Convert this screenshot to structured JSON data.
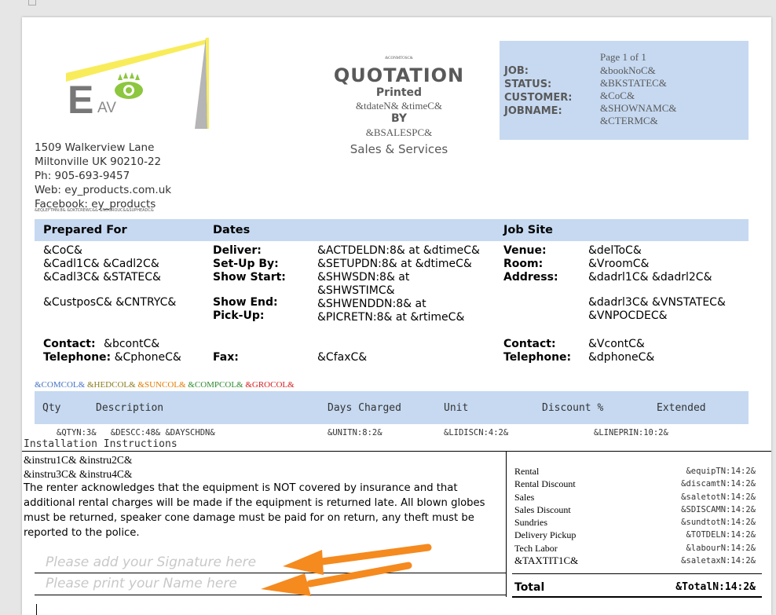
{
  "colors": {
    "accent_band": "#c6d9f1",
    "arrow": "#f58a1f",
    "logo_yellow": "#f8ec5a",
    "logo_green": "#8dc63f",
    "logo_gray": "#b5b5b5",
    "logo_text": "#777777"
  },
  "logo": {
    "letter": "E",
    "suffix": "AV"
  },
  "company": {
    "address1": "1509 Walkerview Lane",
    "address2": "Miltonville UK 90210-22",
    "phone": "Ph: 905-693-9457",
    "web": "Web: ey_products.com.uk",
    "facebook": "Facebook: ey_products",
    "tiny_line": "&EQLEFTMN:8& &DKTCREWC&& &NOGROUC&&SUPHEADC&"
  },
  "header": {
    "tiny_code": "&CONMTOSC&",
    "title": "QUOTATION",
    "printed": "Printed",
    "date_line": "&tdateN& &timeC&",
    "by": "BY",
    "salesp": "&BSALESPC&",
    "services": "Sales & Services"
  },
  "jobbox": {
    "page": "Page 1 of 1",
    "labels": [
      "JOB:",
      "STATUS:",
      "CUSTOMER:",
      "JOBNAME:"
    ],
    "values": [
      "&bookNoC&",
      "&BKSTATEC&",
      "&CoC&",
      "&SHOWNAMC&",
      "&CTERMC&"
    ]
  },
  "band1": {
    "prepared": "Prepared For",
    "dates": "Dates",
    "jobsite": "Job Site"
  },
  "prepared": {
    "line1": "&CoC&",
    "line2": "&Cadl1C& &Cadl2C&",
    "line3": "&Cadl3C& &STATEC&",
    "line4": "&CustposC& &CNTRYC&",
    "contact_label": "Contact:",
    "contact_value": "&bcontC&",
    "tel_label": "Telephone:",
    "tel_value": "&CphoneC&"
  },
  "dates": {
    "deliver_label": "Deliver:",
    "deliver_value": "&ACTDELDN:8& at &dtimeC&",
    "setup_label": "Set-Up By:",
    "setup_value": "&SETUPDN:8& at &dtimeC&",
    "showstart_label": "Show Start:",
    "showstart_value1": "&SHWSDN:8& at",
    "showstart_value2": "&SHWSTIMC&",
    "showend_label": "Show End:",
    "showend_value": "&SHWENDDN:8& at",
    "pickup_label": "Pick-Up:",
    "pickup_value": "&PICRETN:8& at &rtimeC&",
    "fax_label": "Fax:",
    "fax_value": "&CfaxC&"
  },
  "jobsite": {
    "venue_label": "Venue:",
    "venue_value": "&delToC&",
    "room_label": "Room:",
    "room_value": "&VroomC&",
    "address_label": "Address:",
    "address_value": "&dadrl1C& &dadrl2C&",
    "address_value2": "&dadrl3C& &VNSTATEC&",
    "address_value3": "&VNPOCDEC&",
    "contact_label": "Contact:",
    "contact_value": "&VcontC&",
    "tel_label": "Telephone:",
    "tel_value": "&dphoneC&"
  },
  "colcodes": [
    {
      "text": "&COMCOL&",
      "color": "#4472c4"
    },
    {
      "text": "&HEDCOL&",
      "color": "#8a7a1e"
    },
    {
      "text": "&SUNCOL&",
      "color": "#e07b00"
    },
    {
      "text": "&COMPCOL&",
      "color": "#2e8b2e"
    },
    {
      "text": "&GROCOL&",
      "color": "#d42020"
    }
  ],
  "table": {
    "headers": [
      "Qty",
      "Description",
      "Days Charged",
      "Unit",
      "Discount %",
      "Extended"
    ],
    "row": [
      "&QTYN:3&",
      "&DESCC:48&",
      "&DAYSCHDN&",
      "&UNITN:8:2&",
      "&LIDISCN:4:2&",
      "&LINEPRIN:10:2&"
    ]
  },
  "install": {
    "title": "Installation Instructions",
    "line1": "&instru1C& &instru2C&",
    "line2": "&instru3C& &instru4C&",
    "terms": "The renter acknowledges that the equipment is NOT covered by insurance and that additional rental charges will be made if the equipment is returned late. All blown globes must be returned, speaker cone damage must be paid for on return,  any theft must be reported to the police."
  },
  "signature": {
    "sign_placeholder": "Please add your Signature here",
    "name_placeholder": "Please print your Name here"
  },
  "totals": {
    "rows": [
      {
        "label": "Rental",
        "value": "&equipTN:14:2&"
      },
      {
        "label": "Rental Discount",
        "value": "&discamtN:14:2&"
      },
      {
        "label": "Sales",
        "value": "&saletotN:14:2&"
      },
      {
        "label": "Sales Discount",
        "value": "&SDISCAMN:14:2&"
      },
      {
        "label": "Sundries",
        "value": "&sundtotN:14:2&"
      },
      {
        "label": "Delivery Pickup",
        "value": "&TOTDELN:14:2&"
      },
      {
        "label": "Tech Labor",
        "value": "&labourN:14:2&"
      },
      {
        "label": "&TAXTIT1C&",
        "value": "&saletaxN:14:2&"
      }
    ],
    "total_label": "Total",
    "total_value": "&TotalN:14:2&"
  }
}
